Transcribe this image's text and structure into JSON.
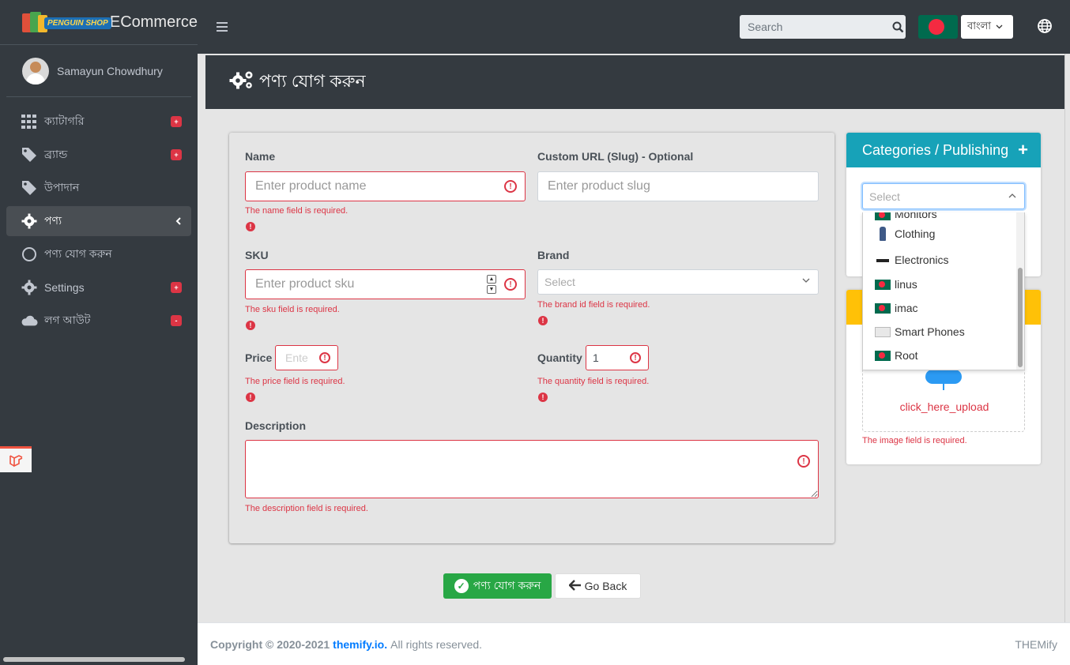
{
  "brand": {
    "logo_text": "PENGUIN SHOP",
    "name": "ECommerce"
  },
  "user": {
    "name": "Samayun Chowdhury"
  },
  "sidebar": {
    "items": [
      {
        "label": "ক্যাটাগরি",
        "icon": "grid-icon",
        "badge": "+"
      },
      {
        "label": "ব্র্যান্ড",
        "icon": "tag-icon",
        "badge": "+"
      },
      {
        "label": "উপাদান",
        "icon": "tag-icon",
        "badge": ""
      },
      {
        "label": "পণ্য",
        "icon": "gear-icon",
        "badge": ""
      },
      {
        "label": "পণ্য যোগ করুন",
        "icon": "circle-icon",
        "badge": ""
      },
      {
        "label": "Settings",
        "icon": "gear-icon",
        "badge": "+"
      },
      {
        "label": "লগ আউট",
        "icon": "cloud-icon",
        "badge": "-"
      }
    ]
  },
  "topbar": {
    "search_placeholder": "Search",
    "language": "বাংলা"
  },
  "page": {
    "title": "পণ্য যোগ করুন"
  },
  "form": {
    "name": {
      "label": "Name",
      "placeholder": "Enter product name",
      "error": "The name field is required."
    },
    "slug": {
      "label": "Custom URL (Slug) - Optional",
      "placeholder": "Enter product slug"
    },
    "sku": {
      "label": "SKU",
      "placeholder": "Enter product sku",
      "error": "The sku field is required."
    },
    "brand": {
      "label": "Brand",
      "placeholder": "Select",
      "error": "The brand id field is required."
    },
    "price": {
      "label": "Price",
      "placeholder": "Ente",
      "error": "The price field is required."
    },
    "quantity": {
      "label": "Quantity",
      "value": "1",
      "error": "The quantity field is required."
    },
    "description": {
      "label": "Description",
      "error": "The description field is required."
    }
  },
  "categories": {
    "title": "Categories / Publishing",
    "placeholder": "Select",
    "options": [
      "Monitors",
      "Clothing",
      "Electronics",
      "linus",
      "imac",
      "Smart Phones",
      "Root"
    ]
  },
  "image": {
    "upload_label": "click_here_upload",
    "error": "The image field is required."
  },
  "buttons": {
    "submit": "পণ্য যোগ করুন",
    "back": "Go Back"
  },
  "footer": {
    "copyright": "Copyright © 2020-2021",
    "link": "themify.io.",
    "rights": "All rights reserved.",
    "right": "THEMify"
  },
  "colors": {
    "accent_teal": "#17a2b8",
    "warning": "#ffc107",
    "danger": "#dc3545",
    "success": "#28a745",
    "sidebar": "#343a40"
  }
}
